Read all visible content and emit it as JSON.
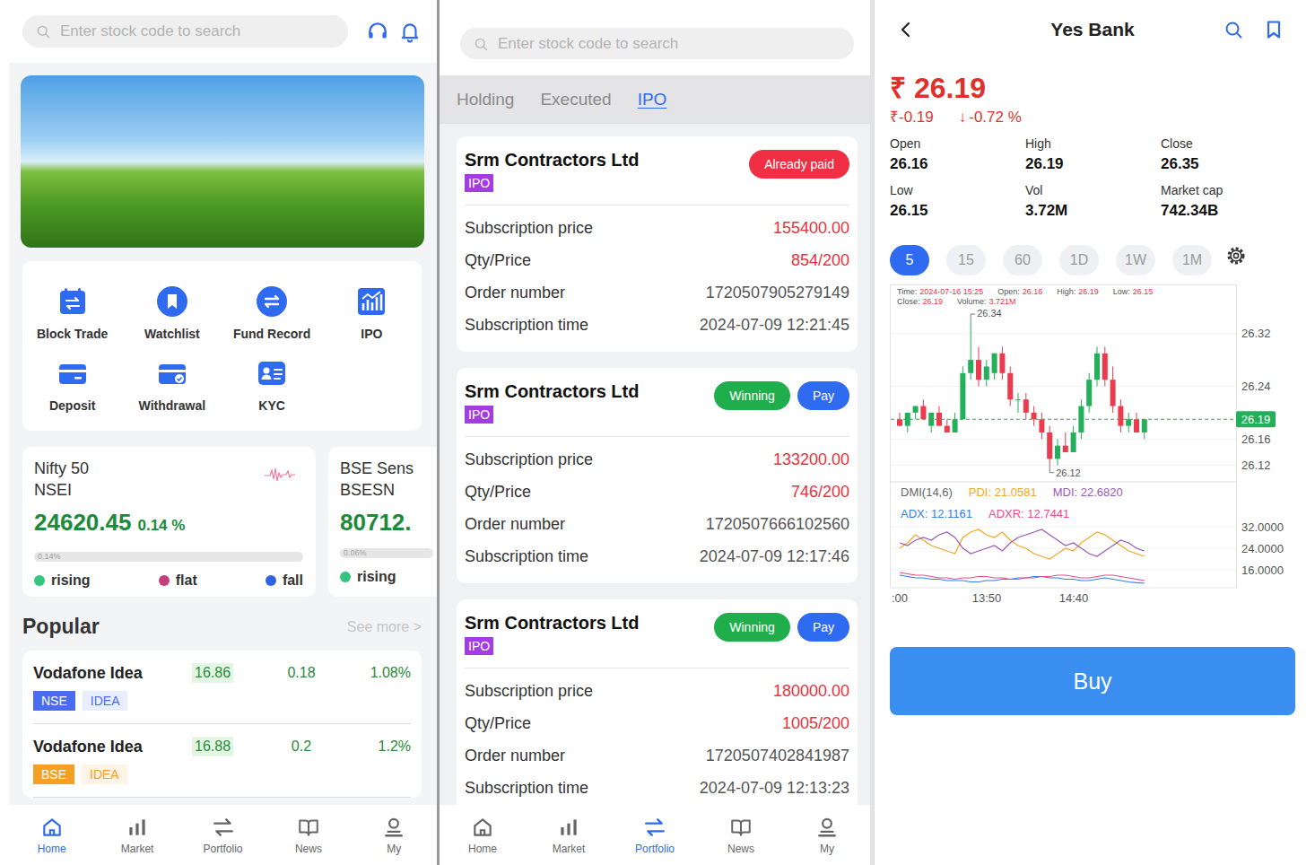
{
  "home": {
    "search": {
      "placeholder": "Enter stock code to search"
    },
    "menu": [
      "Block Trade",
      "Watchlist",
      "Fund Record",
      "IPO",
      "Deposit",
      "Withdrawal",
      "KYC"
    ],
    "indices": [
      {
        "name": "Nifty 50",
        "code": "NSEI",
        "value": "24620.45",
        "change": "0.14 %",
        "bar_text": "0.14%",
        "legend": [
          {
            "label": "rising",
            "color": "#35c47c"
          },
          {
            "label": "flat",
            "color": "#c73d7b"
          },
          {
            "label": "fall",
            "color": "#2f63e6"
          }
        ]
      },
      {
        "name": "BSE Sens",
        "code": "BSESN",
        "value": "80712.",
        "bar_text": "0.06%",
        "legend": [
          {
            "label": "rising",
            "color": "#35c47c"
          }
        ]
      }
    ],
    "popular": {
      "title": "Popular",
      "more": "See more >",
      "rows": [
        {
          "name": "Vodafone Idea",
          "price": "16.86",
          "change": "0.18",
          "percent": "1.08%",
          "exchange": "NSE",
          "symbol": "IDEA",
          "color": "#4a6cf0"
        },
        {
          "name": "Vodafone Idea",
          "price": "16.88",
          "change": "0.2",
          "percent": "1.2%",
          "exchange": "BSE",
          "symbol": "IDEA",
          "color": "#f5a023"
        }
      ]
    },
    "nav": [
      {
        "label": "Home",
        "selected": true
      },
      {
        "label": "Market",
        "selected": false
      },
      {
        "label": "Portfolio",
        "selected": false
      },
      {
        "label": "News",
        "selected": false
      },
      {
        "label": "My",
        "selected": false
      }
    ]
  },
  "portfolio": {
    "search": {
      "placeholder": "Enter stock code to search"
    },
    "tabs": [
      {
        "label": "Holding",
        "selected": false
      },
      {
        "label": "Executed",
        "selected": false
      },
      {
        "label": "IPO",
        "selected": true
      }
    ],
    "orders": [
      {
        "name": "Srm Contractors Ltd",
        "tag": "IPO",
        "badges": [
          {
            "label": "Already paid",
            "color": "#f02e44"
          }
        ],
        "fields": [
          {
            "label": "Subscription price",
            "value": "155400.00",
            "kind": "amount"
          },
          {
            "label": "Qty/Price",
            "value": "854/200",
            "kind": "amount"
          },
          {
            "label": "Order number",
            "value": "1720507905279149",
            "kind": "plain"
          },
          {
            "label": "Subscription time",
            "value": "2024-07-09 12:21:45",
            "kind": "plain"
          }
        ]
      },
      {
        "name": "Srm Contractors Ltd",
        "tag": "IPO",
        "badges": [
          {
            "label": "Winning",
            "color": "#1fae4b"
          },
          {
            "label": "Pay",
            "color": "#2f6bf0"
          }
        ],
        "fields": [
          {
            "label": "Subscription price",
            "value": "133200.00",
            "kind": "amount"
          },
          {
            "label": "Qty/Price",
            "value": "746/200",
            "kind": "amount"
          },
          {
            "label": "Order number",
            "value": "1720507666102560",
            "kind": "plain"
          },
          {
            "label": "Subscription time",
            "value": "2024-07-09 12:17:46",
            "kind": "plain"
          }
        ]
      },
      {
        "name": "Srm Contractors Ltd",
        "tag": "IPO",
        "badges": [
          {
            "label": "Winning",
            "color": "#1fae4b"
          },
          {
            "label": "Pay",
            "color": "#2f6bf0"
          }
        ],
        "fields": [
          {
            "label": "Subscription price",
            "value": "180000.00",
            "kind": "amount"
          },
          {
            "label": "Qty/Price",
            "value": "1005/200",
            "kind": "amount"
          },
          {
            "label": "Order number",
            "value": "1720507402841987",
            "kind": "plain"
          },
          {
            "label": "Subscription time",
            "value": "2024-07-09 12:13:23",
            "kind": "plain"
          }
        ]
      }
    ],
    "nav": [
      {
        "label": "Home",
        "selected": false
      },
      {
        "label": "Market",
        "selected": false
      },
      {
        "label": "Portfolio",
        "selected": true
      },
      {
        "label": "News",
        "selected": false
      },
      {
        "label": "My",
        "selected": false
      }
    ]
  },
  "stock": {
    "title": "Yes Bank",
    "price": "₹ 26.19",
    "change": "₹-0.19",
    "arrow": "↓",
    "percent": "-0.72 %",
    "stats": [
      {
        "label": "Open",
        "value": "26.16"
      },
      {
        "label": "High",
        "value": "26.19"
      },
      {
        "label": "Close",
        "value": "26.35"
      },
      {
        "label": "Low",
        "value": "26.15"
      },
      {
        "label": "Vol",
        "value": "3.72M"
      },
      {
        "label": "Market cap",
        "value": "742.34B"
      }
    ],
    "intervals": [
      {
        "label": "5",
        "selected": true
      },
      {
        "label": "15",
        "selected": false
      },
      {
        "label": "60",
        "selected": false
      },
      {
        "label": "1D",
        "selected": false
      },
      {
        "label": "1W",
        "selected": false
      },
      {
        "label": "1M",
        "selected": false
      }
    ],
    "chart": {
      "tooltip": [
        {
          "label": "Time:",
          "value": "2024-07-16 15:25"
        },
        {
          "label": "Open:",
          "value": "26.16"
        },
        {
          "label": "High:",
          "value": "26.19"
        },
        {
          "label": "Low:",
          "value": "26.15"
        },
        {
          "label": "Close:",
          "value": "26.19"
        },
        {
          "label": "Volume:",
          "value": "3.721M"
        }
      ],
      "y_ticks": [
        "26.32",
        "26.24",
        "26.16",
        "26.12"
      ],
      "last": "26.19",
      "high_mark": "26.34",
      "low_mark": "26.12",
      "candles": [
        {
          "open": 26.19,
          "high": 26.2,
          "low": 26.18,
          "close": 26.18
        },
        {
          "open": 26.18,
          "high": 26.2,
          "low": 26.17,
          "close": 26.2
        },
        {
          "open": 26.2,
          "high": 26.21,
          "low": 26.19,
          "close": 26.21
        },
        {
          "open": 26.21,
          "high": 26.22,
          "low": 26.19,
          "close": 26.19
        },
        {
          "open": 26.18,
          "high": 26.2,
          "low": 26.17,
          "close": 26.2
        },
        {
          "open": 26.2,
          "high": 26.21,
          "low": 26.18,
          "close": 26.18
        },
        {
          "open": 26.18,
          "high": 26.19,
          "low": 26.17,
          "close": 26.17
        },
        {
          "open": 26.17,
          "high": 26.2,
          "low": 26.17,
          "close": 26.19
        },
        {
          "open": 26.19,
          "high": 26.27,
          "low": 26.19,
          "close": 26.26
        },
        {
          "open": 26.26,
          "high": 26.34,
          "low": 26.25,
          "close": 26.28
        },
        {
          "open": 26.28,
          "high": 26.3,
          "low": 26.24,
          "close": 26.25
        },
        {
          "open": 26.25,
          "high": 26.28,
          "low": 26.24,
          "close": 26.27
        },
        {
          "open": 26.26,
          "high": 26.29,
          "low": 26.25,
          "close": 26.29
        },
        {
          "open": 26.29,
          "high": 26.3,
          "low": 26.25,
          "close": 26.26
        },
        {
          "open": 26.26,
          "high": 26.27,
          "low": 26.21,
          "close": 26.22
        },
        {
          "open": 26.22,
          "high": 26.23,
          "low": 26.2,
          "close": 26.22
        },
        {
          "open": 26.22,
          "high": 26.23,
          "low": 26.19,
          "close": 26.2
        },
        {
          "open": 26.2,
          "high": 26.21,
          "low": 26.18,
          "close": 26.19
        },
        {
          "open": 26.19,
          "high": 26.2,
          "low": 26.16,
          "close": 26.17
        },
        {
          "open": 26.17,
          "high": 26.18,
          "low": 26.12,
          "close": 26.13
        },
        {
          "open": 26.13,
          "high": 26.16,
          "low": 26.12,
          "close": 26.15
        },
        {
          "open": 26.15,
          "high": 26.17,
          "low": 26.14,
          "close": 26.14
        },
        {
          "open": 26.14,
          "high": 26.18,
          "low": 26.14,
          "close": 26.17
        },
        {
          "open": 26.17,
          "high": 26.22,
          "low": 26.16,
          "close": 26.21
        },
        {
          "open": 26.21,
          "high": 26.26,
          "low": 26.2,
          "close": 26.25
        },
        {
          "open": 26.25,
          "high": 26.3,
          "low": 26.24,
          "close": 26.29
        },
        {
          "open": 26.29,
          "high": 26.3,
          "low": 26.24,
          "close": 26.25
        },
        {
          "open": 26.25,
          "high": 26.27,
          "low": 26.2,
          "close": 26.21
        },
        {
          "open": 26.21,
          "high": 26.22,
          "low": 26.17,
          "close": 26.18
        },
        {
          "open": 26.18,
          "high": 26.2,
          "low": 26.17,
          "close": 26.19
        },
        {
          "open": 26.19,
          "high": 26.2,
          "low": 26.17,
          "close": 26.17
        },
        {
          "open": 26.17,
          "high": 26.19,
          "low": 26.16,
          "close": 26.19
        }
      ],
      "indicator": {
        "title": "DMI(14,6)",
        "y_ticks": [
          "32.0000",
          "24.0000",
          "16.0000"
        ],
        "series": [
          {
            "label": "PDI: 21.0581",
            "color": "#f5a623",
            "values": [
              24,
              26,
              29,
              27,
              25,
              24,
              23,
              22,
              28,
              30,
              31,
              29,
              28,
              30,
              27,
              25,
              24,
              22,
              21,
              20,
              22,
              24,
              23,
              26,
              28,
              30,
              29,
              27,
              25,
              23,
              22,
              21
            ]
          },
          {
            "label": "MDI: 22.6820",
            "color": "#9b59b6",
            "values": [
              26,
              25,
              27,
              28,
              27,
              29,
              30,
              28,
              24,
              22,
              23,
              24,
              25,
              23,
              26,
              28,
              29,
              30,
              31,
              29,
              27,
              25,
              26,
              24,
              22,
              21,
              23,
              25,
              27,
              26,
              24,
              23
            ]
          },
          {
            "label": "ADX: 12.1161",
            "color": "#2f80ed",
            "values": [
              14,
              13.5,
              13,
              13,
              12.5,
              12.5,
              12,
              12,
              12,
              11.5,
              11.5,
              12,
              12,
              12.5,
              12.5,
              13,
              13,
              13.5,
              13.5,
              13,
              13,
              12.5,
              12.5,
              12,
              12,
              12.5,
              13,
              12.5,
              12,
              11.5,
              11.2,
              11
            ]
          },
          {
            "label": "ADXR: 12.7441",
            "color": "#e74c8b",
            "values": [
              15,
              14.5,
              14,
              14,
              13.5,
              13,
              13,
              12.5,
              13,
              13,
              13.5,
              13.5,
              13,
              13,
              12.5,
              12.5,
              13,
              13,
              13.5,
              13.5,
              14,
              14,
              13.5,
              13,
              13,
              13.5,
              14,
              14,
              13.5,
              13,
              12.5,
              12
            ]
          }
        ]
      },
      "x_ticks": [
        ":00",
        "13:50",
        "14:40"
      ]
    },
    "button": "Buy"
  }
}
